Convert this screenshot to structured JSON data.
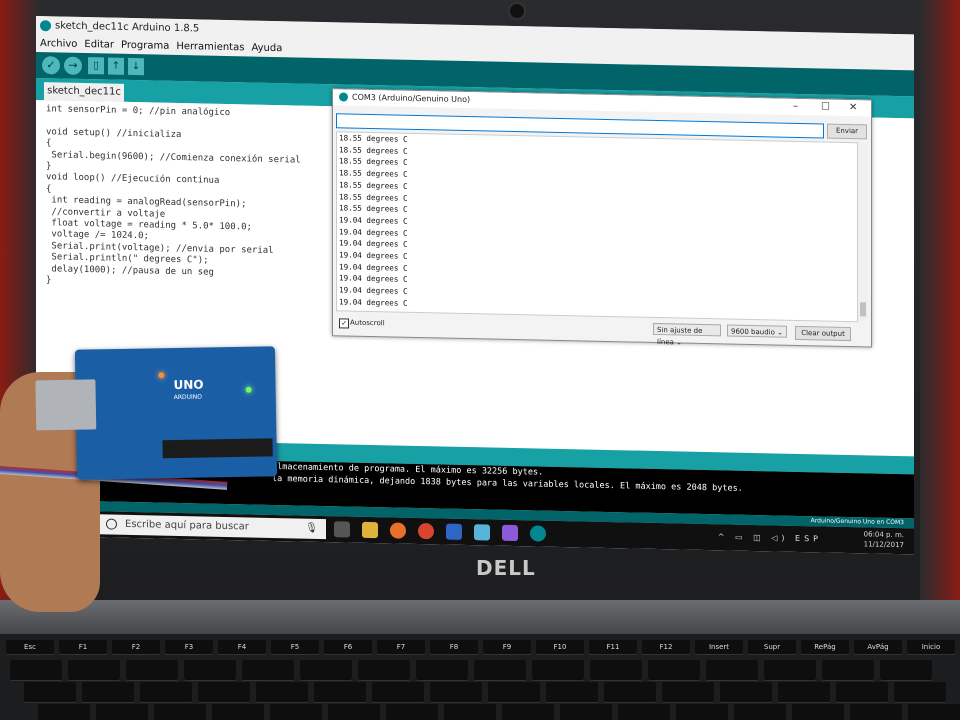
{
  "ide": {
    "window_title": "sketch_dec11c Arduino 1.8.5",
    "menu": [
      "Archivo",
      "Editar",
      "Programa",
      "Herramientas",
      "Ayuda"
    ],
    "tab_label": "sketch_dec11c",
    "code_lines": [
      "int sensorPin = 0; //pin analógico",
      "",
      "void setup() //inicializa",
      "{",
      " Serial.begin(9600); //Comienza conexión serial",
      "}",
      "void loop() //Ejecución continua",
      "{",
      " int reading = analogRead(sensorPin);",
      " //convertir a voltaje",
      " float voltage = reading * 5.0* 100.0;",
      " voltage /= 1024.0;",
      " Serial.print(voltage); //envia por serial",
      " Serial.println(\" degrees C\");",
      " delay(1000); //pausa de un seg",
      "}"
    ],
    "console_lines": [
      "almacenamiento de programa. El máximo es 32256 bytes.",
      "la memoria dinámica, dejando 1838 bytes para las variables locales. El máximo es 2048 bytes."
    ],
    "status_board": "Arduino/Genuino Uno en COM3"
  },
  "serial_monitor": {
    "title": "COM3 (Arduino/Genuino Uno)",
    "send_label": "Enviar",
    "output_lines": [
      "18.55 degrees C",
      "18.55 degrees C",
      "18.55 degrees C",
      "18.55 degrees C",
      "18.55 degrees C",
      "18.55 degrees C",
      "18.55 degrees C",
      "19.04 degrees C",
      "19.04 degrees C",
      "19.04 degrees C",
      "19.04 degrees C",
      "19.04 degrees C",
      "19.04 degrees C",
      "19.04 degrees C",
      "19.04 degrees C"
    ],
    "autoscroll_label": "Autoscroll",
    "line_ending": "Sin ajuste de línea",
    "baud": "9600 baudio",
    "clear_label": "Clear output"
  },
  "taskbar": {
    "search_placeholder": "Escribe aquí para buscar",
    "language": "ESP",
    "time": "06:04 p. m.",
    "date": "11/12/2017"
  },
  "laptop": {
    "brand": "DELL"
  },
  "board": {
    "name": "UNO",
    "maker": "ARDUINO"
  },
  "keyboard": {
    "fn_row": [
      "Esc",
      "F1",
      "F2",
      "F3",
      "F4",
      "F5",
      "F6",
      "F7",
      "F8",
      "F9",
      "F10",
      "F11",
      "F12",
      "Insert",
      "Supr",
      "RePág",
      "AvPág",
      "Inicio"
    ]
  },
  "colors": {
    "arduino_teal": "#00878f",
    "toolbar": "#006468",
    "tabbar": "#17a1a5"
  }
}
